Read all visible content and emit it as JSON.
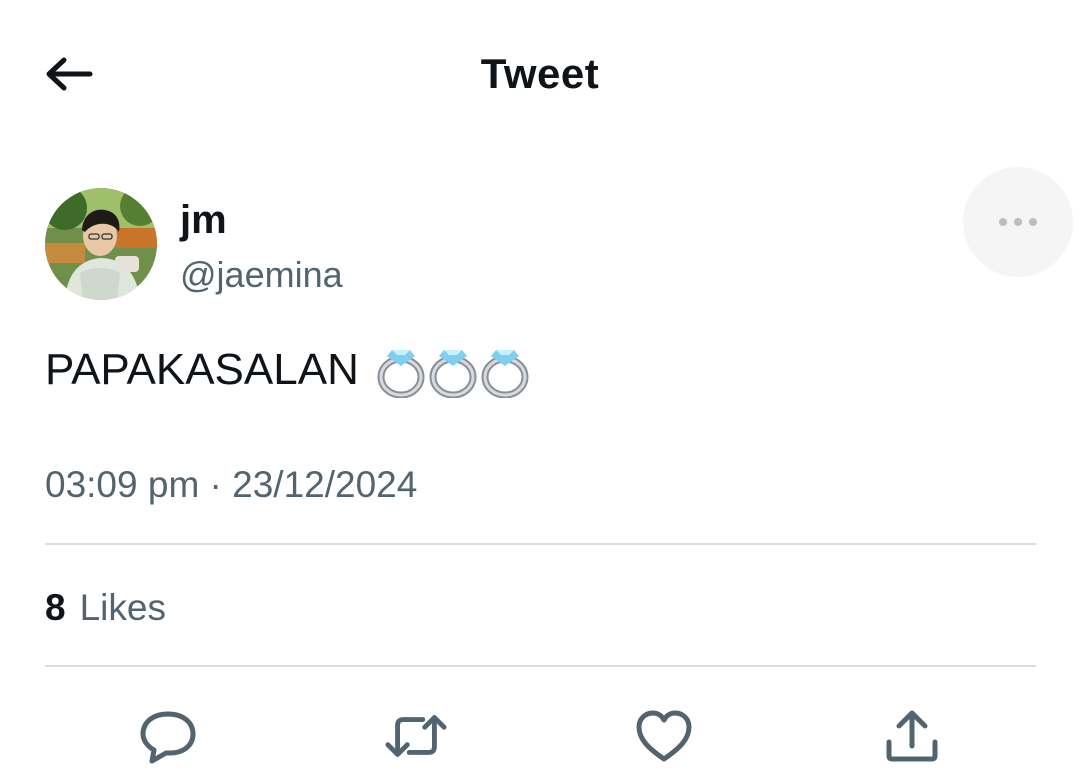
{
  "header": {
    "title": "Tweet",
    "back_icon": "arrow-left-icon"
  },
  "tweet": {
    "author": {
      "display_name": "jm",
      "handle": "@jaemina"
    },
    "text": "PAPAKASALAN",
    "emoji": "💍💍💍",
    "timestamp": "03:09 pm · 23/12/2024",
    "likes": {
      "count": "8",
      "label": "Likes"
    }
  },
  "actions": [
    {
      "name": "reply",
      "icon": "comment-icon"
    },
    {
      "name": "retweet",
      "icon": "retweet-icon"
    },
    {
      "name": "like",
      "icon": "heart-icon"
    },
    {
      "name": "share",
      "icon": "share-icon"
    }
  ],
  "colors": {
    "text_primary": "#0f1419",
    "text_secondary": "#536471",
    "divider": "#dadde0",
    "icon": "#536471"
  }
}
